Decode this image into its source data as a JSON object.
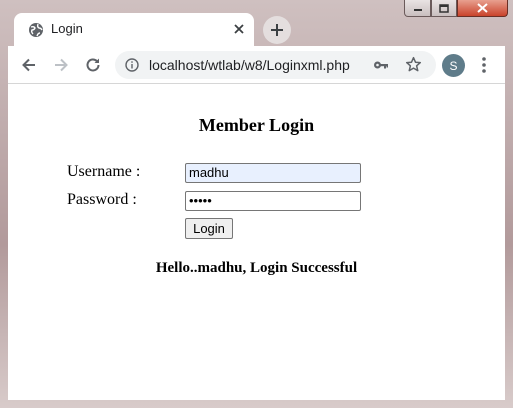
{
  "browser": {
    "tab": {
      "title": "Login",
      "icon": "globe-icon"
    },
    "address_bar": {
      "url": "localhost/wtlab/w8/Loginxml.php"
    },
    "profile": {
      "initial": "S"
    }
  },
  "page": {
    "heading": "Member Login",
    "form": {
      "username_label": "Username :",
      "username_value": "madhu",
      "password_label": "Password :",
      "password_value": "•••••",
      "submit_label": "Login"
    },
    "result_message": "Hello..madhu, Login Successful"
  }
}
